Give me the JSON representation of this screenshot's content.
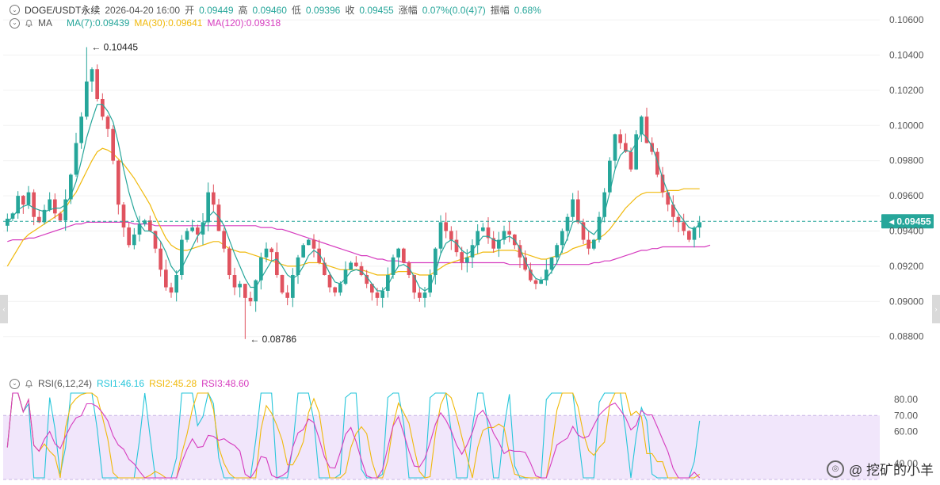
{
  "header": {
    "symbol": "DOGE/USDT永续",
    "datetime": "2026-04-20 16:00",
    "open_label": "开",
    "open": "0.09449",
    "high_label": "高",
    "high": "0.09460",
    "low_label": "低",
    "low": "0.09396",
    "close_label": "收",
    "close": "0.09455",
    "change_label": "涨幅",
    "change": "0.07%(0.0(4)7)",
    "amp_label": "振幅",
    "amp": "0.68%"
  },
  "ma_row": {
    "name": "MA",
    "ma7": "MA(7):0.09439",
    "ma30": "MA(30):0.09641",
    "ma120": "MA(120):0.09318"
  },
  "rsi_row": {
    "name": "RSI(6,12,24)",
    "rsi1": "RSI1:46.16",
    "rsi2": "RSI2:45.28",
    "rsi3": "RSI3:48.60"
  },
  "colors": {
    "up": "#26a69a",
    "down": "#e0535f",
    "ma7": "#26a69a",
    "ma30": "#f0b90b",
    "ma120": "#d63cbf",
    "rsi1": "#26c6da",
    "rsi2": "#f0b90b",
    "rsi3": "#d63cbf",
    "rsi_band": "#f1e6fb",
    "current": "#26a69a"
  },
  "chart_data": [
    {
      "type": "candlestick",
      "title": "DOGE/USDT永续",
      "ylim": [
        0.0865,
        0.1065
      ],
      "y_ticks": [
        "0.08800",
        "0.09000",
        "0.09200",
        "0.09400",
        "0.09600",
        "0.09800",
        "0.10000",
        "0.10200",
        "0.10400",
        "0.10600"
      ],
      "current_price": "0.09455",
      "annotations": [
        {
          "label": "0.10445",
          "value": 0.10445,
          "type": "high"
        },
        {
          "label": "0.08786",
          "value": 0.08786,
          "type": "low"
        }
      ],
      "close_path": [
        0.0947,
        0.095,
        0.096,
        0.0955,
        0.0962,
        0.0948,
        0.0945,
        0.0952,
        0.0958,
        0.095,
        0.0946,
        0.0958,
        0.0972,
        0.099,
        0.1005,
        0.1025,
        0.1032,
        0.1015,
        0.1005,
        0.0998,
        0.098,
        0.0955,
        0.0942,
        0.0932,
        0.0938,
        0.0944,
        0.0946,
        0.094,
        0.093,
        0.0918,
        0.0908,
        0.0905,
        0.0915,
        0.0935,
        0.094,
        0.0942,
        0.0938,
        0.0945,
        0.0962,
        0.0955,
        0.094,
        0.093,
        0.0915,
        0.0908,
        0.091,
        0.0902,
        0.09,
        0.0912,
        0.0925,
        0.093,
        0.0928,
        0.0915,
        0.0905,
        0.0902,
        0.0915,
        0.0925,
        0.0932,
        0.0935,
        0.093,
        0.0922,
        0.0915,
        0.0908,
        0.0905,
        0.091,
        0.0918,
        0.0922,
        0.092,
        0.0915,
        0.091,
        0.0905,
        0.0902,
        0.0906,
        0.0915,
        0.0925,
        0.093,
        0.0922,
        0.0915,
        0.0905,
        0.0902,
        0.0905,
        0.0915,
        0.093,
        0.0945,
        0.094,
        0.0935,
        0.0928,
        0.0922,
        0.0925,
        0.0932,
        0.094,
        0.0942,
        0.0936,
        0.093,
        0.0935,
        0.094,
        0.0938,
        0.0932,
        0.0925,
        0.0918,
        0.0912,
        0.091,
        0.0912,
        0.0918,
        0.0925,
        0.0932,
        0.094,
        0.0948,
        0.0958,
        0.0945,
        0.0935,
        0.093,
        0.0935,
        0.0948,
        0.0962,
        0.098,
        0.0995,
        0.099,
        0.0985,
        0.0975,
        0.0995,
        0.1005,
        0.099,
        0.0985,
        0.0972,
        0.0962,
        0.0955,
        0.0948,
        0.0945,
        0.094,
        0.0935,
        0.0942,
        0.0945
      ],
      "ma7_path": [
        0.0945,
        0.0948,
        0.0952,
        0.0954,
        0.0955,
        0.0953,
        0.0952,
        0.0951,
        0.0952,
        0.0953,
        0.0953,
        0.0955,
        0.096,
        0.0968,
        0.098,
        0.0993,
        0.1003,
        0.1012,
        0.1012,
        0.1008,
        0.1002,
        0.099,
        0.0975,
        0.0962,
        0.0952,
        0.0944,
        0.094,
        0.094,
        0.0938,
        0.0934,
        0.0928,
        0.092,
        0.0916,
        0.0919,
        0.0925,
        0.0931,
        0.0937,
        0.0941,
        0.0948,
        0.0951,
        0.0948,
        0.0943,
        0.0935,
        0.0927,
        0.092,
        0.0913,
        0.0908,
        0.0908,
        0.0913,
        0.0918,
        0.0923,
        0.0924,
        0.092,
        0.0915,
        0.0913,
        0.0915,
        0.092,
        0.0926,
        0.0929,
        0.0927,
        0.0922,
        0.0916,
        0.0911,
        0.091,
        0.0913,
        0.0917,
        0.0918,
        0.0917,
        0.0914,
        0.091,
        0.0906,
        0.0906,
        0.0909,
        0.0915,
        0.092,
        0.0921,
        0.0919,
        0.0914,
        0.0908,
        0.0906,
        0.0908,
        0.0916,
        0.0927,
        0.0933,
        0.0935,
        0.0933,
        0.0929,
        0.0927,
        0.0929,
        0.0933,
        0.0937,
        0.0937,
        0.0935,
        0.0934,
        0.0936,
        0.0937,
        0.0935,
        0.093,
        0.0923,
        0.0917,
        0.0913,
        0.0912,
        0.0913,
        0.0917,
        0.0922,
        0.0929,
        0.0936,
        0.0945,
        0.0946,
        0.0943,
        0.094,
        0.0938,
        0.0942,
        0.095,
        0.0962,
        0.0975,
        0.0983,
        0.0986,
        0.0985,
        0.099,
        0.0996,
        0.0993,
        0.0988,
        0.098,
        0.097,
        0.0962,
        0.0955,
        0.095,
        0.0946,
        0.0942,
        0.0941,
        0.0944
      ],
      "ma30_path": [
        0.092,
        0.0925,
        0.093,
        0.0935,
        0.0938,
        0.094,
        0.0942,
        0.0944,
        0.0946,
        0.0948,
        0.095,
        0.0953,
        0.0958,
        0.0962,
        0.0968,
        0.0974,
        0.098,
        0.0985,
        0.0987,
        0.0986,
        0.0984,
        0.0981,
        0.0978,
        0.0974,
        0.097,
        0.0965,
        0.096,
        0.0955,
        0.0948,
        0.0942,
        0.0936,
        0.0932,
        0.093,
        0.0929,
        0.0929,
        0.093,
        0.0931,
        0.0932,
        0.0933,
        0.0934,
        0.0934,
        0.0932,
        0.093,
        0.0929,
        0.0928,
        0.0928,
        0.0927,
        0.0926,
        0.0925,
        0.0924,
        0.0923,
        0.0922,
        0.0921,
        0.092,
        0.092,
        0.092,
        0.0921,
        0.0922,
        0.0922,
        0.0922,
        0.0921,
        0.092,
        0.0919,
        0.0918,
        0.0918,
        0.0918,
        0.0918,
        0.0918,
        0.0917,
        0.0916,
        0.0915,
        0.0915,
        0.0915,
        0.0916,
        0.0917,
        0.0917,
        0.0917,
        0.0916,
        0.0915,
        0.0915,
        0.0915,
        0.0917,
        0.0919,
        0.0921,
        0.0922,
        0.0923,
        0.0924,
        0.0925,
        0.0926,
        0.0927,
        0.0928,
        0.0928,
        0.0928,
        0.0929,
        0.0929,
        0.0929,
        0.0929,
        0.0928,
        0.0927,
        0.0926,
        0.0925,
        0.0924,
        0.0924,
        0.0925,
        0.0926,
        0.0927,
        0.0928,
        0.093,
        0.0931,
        0.0932,
        0.0933,
        0.0934,
        0.0936,
        0.0938,
        0.0941,
        0.0945,
        0.0949,
        0.0953,
        0.0956,
        0.0959,
        0.0961,
        0.0962,
        0.0962,
        0.0962,
        0.0962,
        0.0963,
        0.0963,
        0.0963,
        0.0964,
        0.0964,
        0.0964,
        0.0964
      ],
      "ma120_path": [
        0.0934,
        0.0935,
        0.0935,
        0.0935,
        0.0936,
        0.0936,
        0.0937,
        0.0938,
        0.0939,
        0.094,
        0.0941,
        0.0942,
        0.0943,
        0.0944,
        0.0944,
        0.0945,
        0.0945,
        0.0945,
        0.0945,
        0.0945,
        0.0945,
        0.0945,
        0.0945,
        0.0945,
        0.0944,
        0.0944,
        0.0944,
        0.0944,
        0.0943,
        0.0943,
        0.0943,
        0.0943,
        0.0943,
        0.0943,
        0.0943,
        0.0943,
        0.0943,
        0.0943,
        0.0943,
        0.0943,
        0.0943,
        0.0943,
        0.0943,
        0.0943,
        0.0943,
        0.0943,
        0.0943,
        0.0943,
        0.0942,
        0.0942,
        0.0942,
        0.0941,
        0.0941,
        0.094,
        0.0939,
        0.0938,
        0.0937,
        0.0936,
        0.0935,
        0.0934,
        0.0933,
        0.0932,
        0.0931,
        0.093,
        0.0929,
        0.0928,
        0.0927,
        0.0926,
        0.0926,
        0.0925,
        0.0924,
        0.0924,
        0.0923,
        0.0923,
        0.0923,
        0.0922,
        0.0922,
        0.0922,
        0.0922,
        0.0922,
        0.0922,
        0.0922,
        0.0922,
        0.0922,
        0.0922,
        0.0922,
        0.0922,
        0.0922,
        0.0922,
        0.0922,
        0.0922,
        0.0922,
        0.0922,
        0.0922,
        0.0922,
        0.0921,
        0.0921,
        0.0921,
        0.0921,
        0.0921,
        0.0921,
        0.0921,
        0.0921,
        0.0921,
        0.0921,
        0.0921,
        0.0921,
        0.0921,
        0.0921,
        0.0921,
        0.0921,
        0.0922,
        0.0922,
        0.0923,
        0.0923,
        0.0924,
        0.0925,
        0.0926,
        0.0927,
        0.0928,
        0.0929,
        0.0929,
        0.093,
        0.093,
        0.0931,
        0.0931,
        0.0931,
        0.0931,
        0.0931,
        0.0931,
        0.0931,
        0.0931,
        0.0931,
        0.0932
      ]
    },
    {
      "type": "line",
      "title": "RSI(6,12,24)",
      "ylim": [
        30,
        85
      ],
      "y_ticks": [
        "80.00",
        "70.00",
        "60.00",
        "40.00"
      ],
      "band": [
        30,
        70
      ],
      "series": [
        {
          "name": "RSI1",
          "value": "46.16"
        },
        {
          "name": "RSI2",
          "value": "45.28"
        },
        {
          "name": "RSI3",
          "value": "48.60"
        }
      ]
    }
  ],
  "watermark": {
    "text": "@ 挖矿的小羊"
  }
}
